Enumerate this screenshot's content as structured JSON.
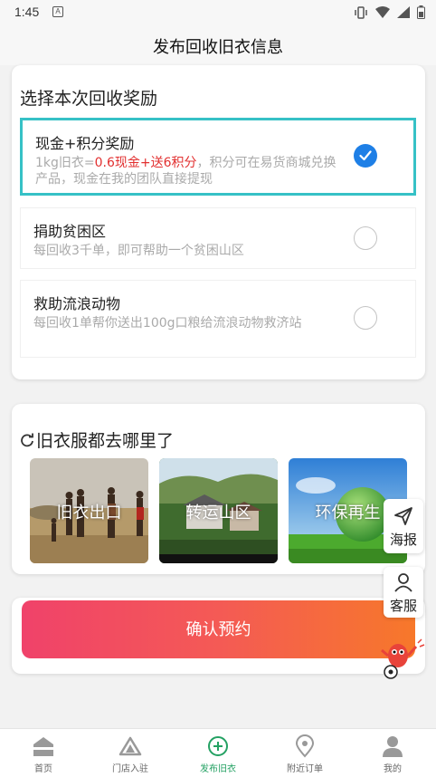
{
  "status_bar": {
    "time": "1:45",
    "notification_glyph": "A"
  },
  "header": {
    "title": "发布回收旧衣信息"
  },
  "reward_section": {
    "title": "选择本次回收奖励",
    "options": [
      {
        "title": "现金+积分奖励",
        "desc_prefix": "1kg旧衣=",
        "desc_highlight": "0.6现金+送6积分",
        "desc_suffix": "，积分可在易货商城兑换产品，现金在我的团队直接提现",
        "selected": true
      },
      {
        "title": "捐助贫困区",
        "desc": "每回收3千单，即可帮助一个贫困山区",
        "selected": false
      },
      {
        "title": "救助流浪动物",
        "desc": "每回收1单帮你送出100g口粮给流浪动物救济站",
        "selected": false
      }
    ]
  },
  "where_section": {
    "title": "旧衣服都去哪里了",
    "icon": "refresh-icon",
    "images": [
      {
        "label": "旧衣出口",
        "scene": "people-in-savanna"
      },
      {
        "label": "转运山区",
        "scene": "mountain-village"
      },
      {
        "label": "环保再生",
        "scene": "green-globe-sky"
      }
    ]
  },
  "confirm_button": {
    "label": "确认预约"
  },
  "floating": {
    "poster_label": "海报",
    "service_label": "客服"
  },
  "tabbar": {
    "items": [
      {
        "label": "首页",
        "icon": "home-icon",
        "active": false
      },
      {
        "label": "门店入驻",
        "icon": "store-icon",
        "active": false
      },
      {
        "label": "发布旧衣",
        "icon": "add-circle-icon",
        "active": true
      },
      {
        "label": "附近订单",
        "icon": "location-pin-icon",
        "active": false
      },
      {
        "label": "我的",
        "icon": "user-icon",
        "active": false
      }
    ]
  },
  "colors": {
    "accent_teal": "#36c1c6",
    "radio_blue": "#1e7fe6",
    "highlight_red": "#e23030",
    "active_tab_green": "#24a163",
    "button_gradient_start": "#f0426a",
    "button_gradient_end": "#f7782a"
  }
}
